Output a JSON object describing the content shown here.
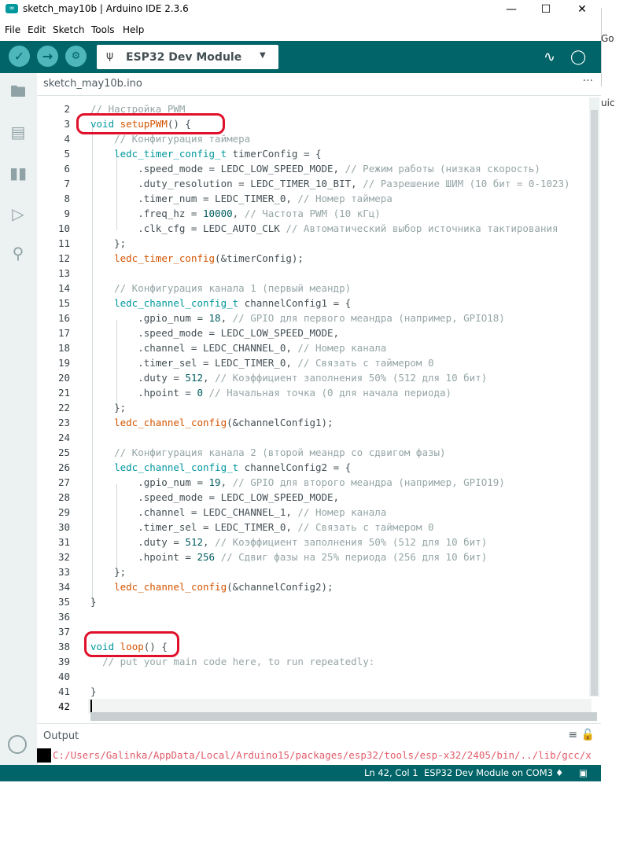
{
  "window": {
    "title": "sketch_may10b | Arduino IDE 2.3.6",
    "app_icon": "arduino-icon",
    "controls": [
      "minimize-icon",
      "maximize-icon",
      "close-icon"
    ]
  },
  "menu": {
    "items": [
      "File",
      "Edit",
      "Sketch",
      "Tools",
      "Help"
    ]
  },
  "toolbar": {
    "verify": "✓",
    "upload": "→",
    "debug": "⚙",
    "board": "ESP32 Dev Module",
    "board_icon": "usb-icon",
    "serial_plotter": "plotter-icon",
    "serial_monitor": "monitor-icon"
  },
  "sidebar": {
    "items": [
      "folder-icon",
      "boards-icon",
      "library-icon",
      "debug-icon",
      "search-icon"
    ],
    "account": "account-icon"
  },
  "tabs": {
    "active": "sketch_may10b.ino",
    "more": "···"
  },
  "editor": {
    "lines": [
      {
        "n": "2",
        "t": "// Настройка PWM"
      },
      {
        "n": "3",
        "t": "void setupPWM() {"
      },
      {
        "n": "4",
        "t": "    // Конфигурация таймера"
      },
      {
        "n": "5",
        "t": "    ledc_timer_config_t timerConfig = {"
      },
      {
        "n": "6",
        "t": "        .speed_mode = LEDC_LOW_SPEED_MODE, // Режим работы (низкая скорость)"
      },
      {
        "n": "7",
        "t": "        .duty_resolution = LEDC_TIMER_10_BIT, // Разрешение ШИМ (10 бит = 0-1023)"
      },
      {
        "n": "8",
        "t": "        .timer_num = LEDC_TIMER_0, // Номер таймера"
      },
      {
        "n": "9",
        "t": "        .freq_hz = 10000, // Частота PWM (10 кГц)"
      },
      {
        "n": "10",
        "t": "        .clk_cfg = LEDC_AUTO_CLK // Автоматический выбор источника тактирования"
      },
      {
        "n": "11",
        "t": "    };"
      },
      {
        "n": "12",
        "t": "    ledc_timer_config(&timerConfig);"
      },
      {
        "n": "13",
        "t": ""
      },
      {
        "n": "14",
        "t": "    // Конфигурация канала 1 (первый меандр)"
      },
      {
        "n": "15",
        "t": "    ledc_channel_config_t channelConfig1 = {"
      },
      {
        "n": "16",
        "t": "        .gpio_num = 18, // GPIO для первого меандра (например, GPIO18)"
      },
      {
        "n": "17",
        "t": "        .speed_mode = LEDC_LOW_SPEED_MODE,"
      },
      {
        "n": "18",
        "t": "        .channel = LEDC_CHANNEL_0, // Номер канала"
      },
      {
        "n": "19",
        "t": "        .timer_sel = LEDC_TIMER_0, // Связать с таймером 0"
      },
      {
        "n": "20",
        "t": "        .duty = 512, // Коэффициент заполнения 50% (512 для 10 бит)"
      },
      {
        "n": "21",
        "t": "        .hpoint = 0 // Начальная точка (0 для начала периода)"
      },
      {
        "n": "22",
        "t": "    };"
      },
      {
        "n": "23",
        "t": "    ledc_channel_config(&channelConfig1);"
      },
      {
        "n": "24",
        "t": ""
      },
      {
        "n": "25",
        "t": "    // Конфигурация канала 2 (второй меандр со сдвигом фазы)"
      },
      {
        "n": "26",
        "t": "    ledc_channel_config_t channelConfig2 = {"
      },
      {
        "n": "27",
        "t": "        .gpio_num = 19, // GPIO для второго меандра (например, GPIO19)"
      },
      {
        "n": "28",
        "t": "        .speed_mode = LEDC_LOW_SPEED_MODE,"
      },
      {
        "n": "29",
        "t": "        .channel = LEDC_CHANNEL_1, // Номер канала"
      },
      {
        "n": "30",
        "t": "        .timer_sel = LEDC_TIMER_0, // Связать с таймером 0"
      },
      {
        "n": "31",
        "t": "        .duty = 512, // Коэффициент заполнения 50% (512 для 10 бит)"
      },
      {
        "n": "32",
        "t": "        .hpoint = 256 // Сдвиг фазы на 25% периода (256 для 10 бит)"
      },
      {
        "n": "33",
        "t": "    };"
      },
      {
        "n": "34",
        "t": "    ledc_channel_config(&channelConfig2);"
      },
      {
        "n": "35",
        "t": "}"
      },
      {
        "n": "36",
        "t": ""
      },
      {
        "n": "37",
        "t": ""
      },
      {
        "n": "38",
        "t": "void loop() {"
      },
      {
        "n": "39",
        "t": "  // put your main code here, to run repeatedly:"
      },
      {
        "n": "40",
        "t": ""
      },
      {
        "n": "41",
        "t": "}"
      },
      {
        "n": "42",
        "t": ""
      }
    ]
  },
  "output": {
    "label": "Output",
    "icons": [
      "clear-output-icon",
      "lock-scroll-icon"
    ],
    "line": "C:/Users/Galinka/AppData/Local/Arduino15/packages/esp32/tools/esp-x32/2405/bin/../lib/gcc/x"
  },
  "status": {
    "position": "Ln 42, Col 1",
    "board_port": "ESP32 Dev Module on COM3",
    "notifications_icon": "bell-icon",
    "panel_icon": "panel-toggle-icon"
  },
  "background_window": {
    "text1": "Go",
    "text2": "uic"
  }
}
